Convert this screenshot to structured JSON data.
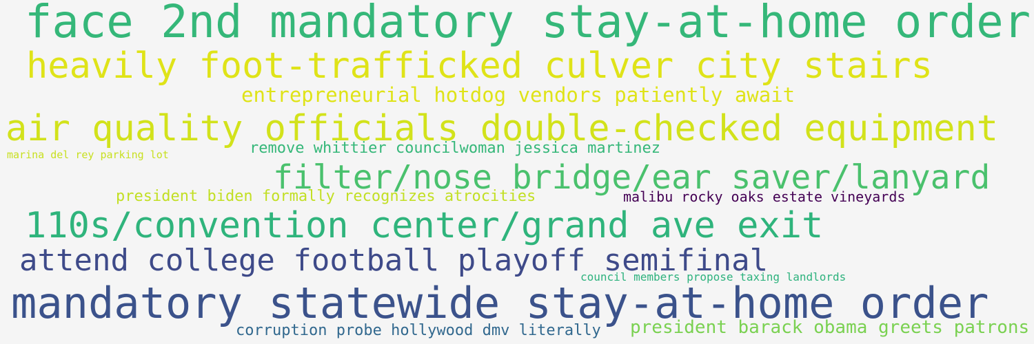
{
  "words": [
    {
      "text": "face 2nd mandatory stay-at-home order",
      "color": "#35b779"
    },
    {
      "text": "heavily foot-trafficked culver city stairs",
      "color": "#dfe318"
    },
    {
      "text": "entrepreneurial hotdog vendors patiently await",
      "color": "#dfe318"
    },
    {
      "text": "air quality officials double-checked equipment",
      "color": "#d2e21b"
    },
    {
      "text": "marina del rey parking lot",
      "color": "#c8e020"
    },
    {
      "text": "remove whittier councilwoman jessica martinez",
      "color": "#35b779"
    },
    {
      "text": "filter/nose bridge/ear saver/lanyard",
      "color": "#4ac16d"
    },
    {
      "text": "president biden formally recognizes atrocities",
      "color": "#c2df23"
    },
    {
      "text": "malibu rocky oaks estate vineyards",
      "color": "#440154"
    },
    {
      "text": "110s/convention center/grand ave exit",
      "color": "#2fb47c"
    },
    {
      "text": "attend college football playoff semifinal",
      "color": "#3e4a89"
    },
    {
      "text": "council members propose taxing landlords",
      "color": "#2db27d"
    },
    {
      "text": "mandatory statewide stay-at-home order",
      "color": "#3b528b"
    },
    {
      "text": "president barack obama greets patrons",
      "color": "#7ad151"
    },
    {
      "text": "corruption probe hollywood dmv literally",
      "color": "#31688e"
    }
  ]
}
